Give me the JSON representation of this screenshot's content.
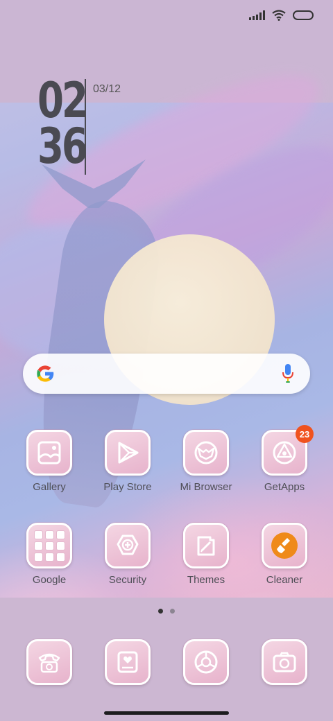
{
  "status_bar": {
    "signal_icon": "signal-icon",
    "wifi_icon": "wifi-icon",
    "battery_icon": "battery-icon"
  },
  "clock": {
    "hours": "02",
    "minutes": "36",
    "date": "03/12"
  },
  "search": {
    "google_icon": "google-g-icon",
    "mic_icon": "mic-icon"
  },
  "apps_row1": [
    {
      "label": "Gallery",
      "icon": "gallery-icon"
    },
    {
      "label": "Play Store",
      "icon": "play-store-icon"
    },
    {
      "label": "Mi Browser",
      "icon": "mi-browser-icon"
    },
    {
      "label": "GetApps",
      "icon": "getapps-icon",
      "badge": "23"
    }
  ],
  "apps_row2": [
    {
      "label": "Google",
      "icon": "google-folder-icon"
    },
    {
      "label": "Security",
      "icon": "security-icon"
    },
    {
      "label": "Themes",
      "icon": "themes-icon"
    },
    {
      "label": "Cleaner",
      "icon": "cleaner-icon"
    }
  ],
  "page_indicator": {
    "count": 2,
    "active": 1
  },
  "dock": [
    {
      "icon": "phone-icon"
    },
    {
      "icon": "messages-icon"
    },
    {
      "icon": "browser-icon"
    },
    {
      "icon": "camera-icon"
    }
  ],
  "colors": {
    "badge": "#f0521e",
    "icon_fill": "#e7b3cc",
    "label": "#4e4e56"
  }
}
